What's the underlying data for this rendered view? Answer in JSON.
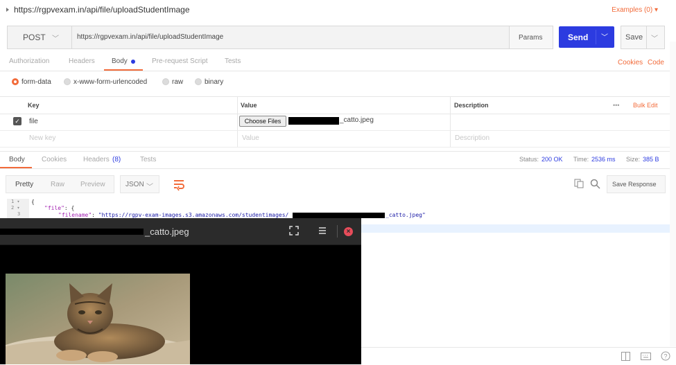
{
  "header": {
    "url_title": "https://rgpvexam.in/api/file/uploadStudentImage",
    "examples_label": "Examples (0) ▾"
  },
  "request": {
    "method": "POST",
    "url": "https://rgpvexam.in/api/file/uploadStudentImage",
    "params_label": "Params",
    "send_label": "Send",
    "save_label": "Save"
  },
  "request_tabs": {
    "items": [
      "Authorization",
      "Headers",
      "Body",
      "Pre-request Script",
      "Tests"
    ],
    "active": "Body",
    "cookies_label": "Cookies",
    "code_label": "Code"
  },
  "body_types": {
    "options": [
      "form-data",
      "x-www-form-urlencoded",
      "raw",
      "binary"
    ],
    "selected": "form-data"
  },
  "form_table": {
    "headers": [
      "Key",
      "Value",
      "Description"
    ],
    "more_label": "•••",
    "bulk_edit_label": "Bulk Edit",
    "rows": [
      {
        "checked": true,
        "key": "file",
        "choose_label": "Choose Files",
        "file_value": "_catto.jpeg",
        "description": ""
      }
    ],
    "new_row": {
      "key_placeholder": "New key",
      "value_placeholder": "Value",
      "description_placeholder": "Description"
    }
  },
  "response_tabs": {
    "items": [
      "Body",
      "Cookies",
      "Headers",
      "Tests"
    ],
    "headers_count": "(8)",
    "active": "Body"
  },
  "response_status": {
    "status_label": "Status:",
    "status_value": "200 OK",
    "time_label": "Time:",
    "time_value": "2536 ms",
    "size_label": "Size:",
    "size_value": "385 B"
  },
  "response_view": {
    "modes": [
      "Pretty",
      "Raw",
      "Preview"
    ],
    "active_mode": "Pretty",
    "format": "JSON",
    "save_response_label": "Save Response"
  },
  "code": {
    "line_numbers": [
      "1 ▾",
      "2 ▾",
      "3"
    ],
    "line1": "{",
    "line2_key": "\"file\"",
    "line2_rest": ": {",
    "line3_key": "\"filename\"",
    "line3_colon": ": ",
    "line3_value_start": "\"https://rgpv-exam-images.s3.amazonaws.com/studentimages/",
    "line3_value_end": "_catto.jpeg\""
  },
  "viewer": {
    "title_suffix": "_catto.jpeg",
    "close_symbol": "×"
  },
  "colors": {
    "accent": "#f26b3a",
    "send": "#2c3be0",
    "close": "#e74c5a"
  }
}
